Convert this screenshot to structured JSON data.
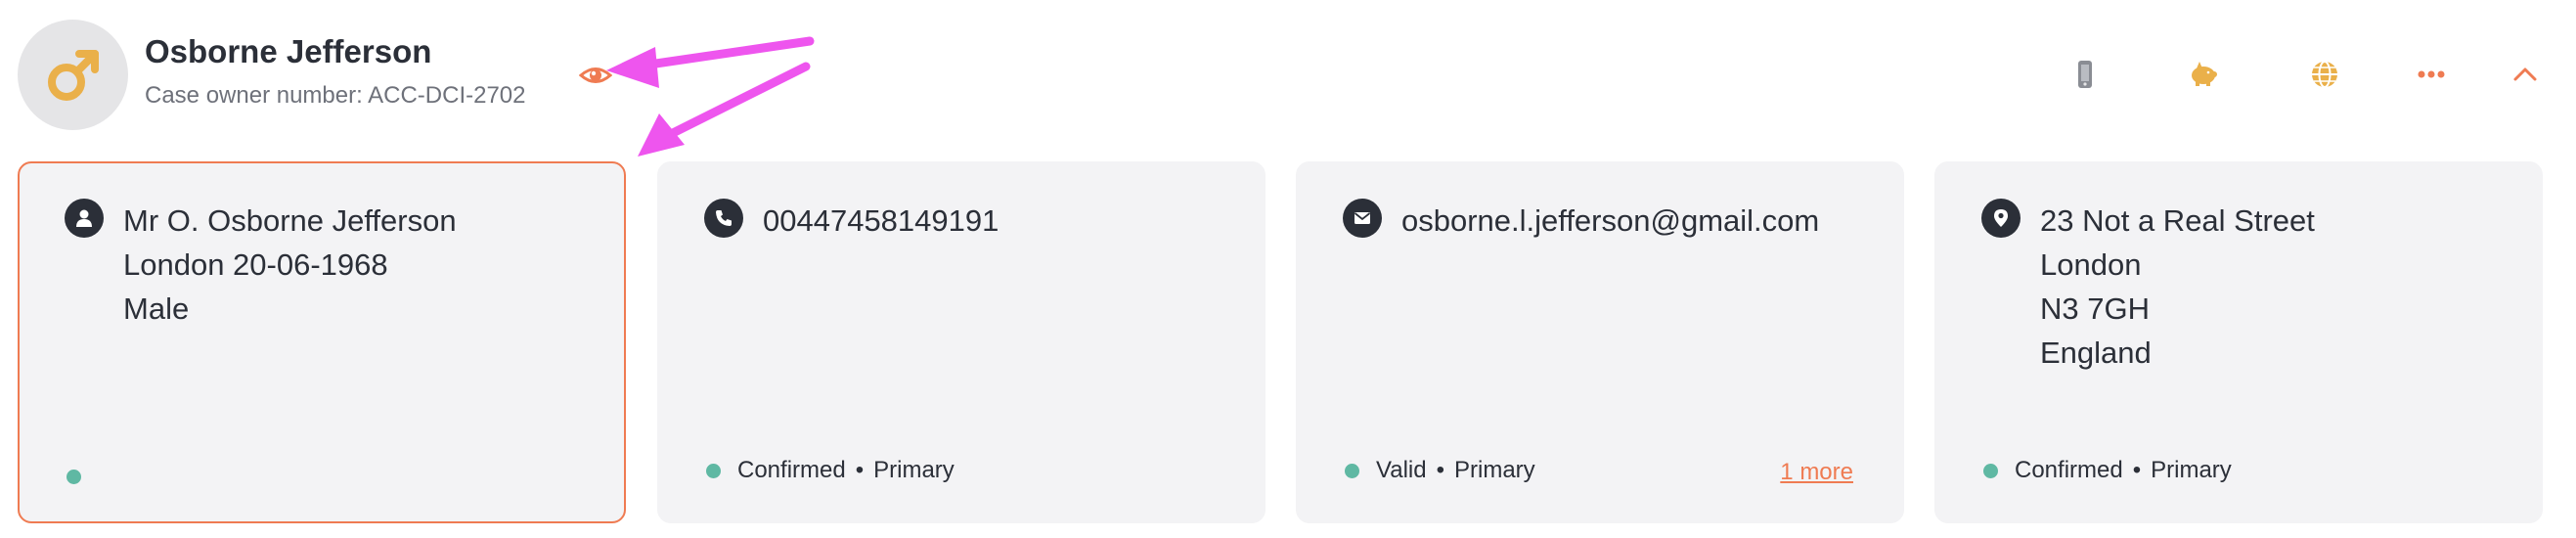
{
  "header": {
    "name": "Osborne Jefferson",
    "case_owner_label": "Case owner number:",
    "case_owner_number": "ACC-DCI-2702"
  },
  "toolbar": {
    "icons": [
      "mobile-phone-icon",
      "piggy-bank-icon",
      "globe-icon",
      "more-options-icon",
      "chevron-up-icon"
    ]
  },
  "cards": {
    "identity": {
      "lines": [
        "Mr O. Osborne Jefferson",
        "London 20-06-1968",
        "Male"
      ]
    },
    "phone": {
      "lines": [
        "00447458149191"
      ],
      "status": "Confirmed",
      "tag": "Primary"
    },
    "email": {
      "lines": [
        "osborne.l.jefferson@gmail.com"
      ],
      "status": "Valid",
      "tag": "Primary",
      "more_link": "1 more"
    },
    "address": {
      "lines": [
        "23 Not a Real Street",
        "London",
        "N3 7GH",
        "England"
      ],
      "status": "Confirmed",
      "tag": "Primary"
    }
  },
  "colors": {
    "accent": "#ef7b52",
    "avatar_symbol": "#eab04a",
    "status_dot": "#5fb8a3",
    "card_bg": "#f3f3f5",
    "annotation_arrow": "#ee55ee"
  },
  "separator": "•"
}
